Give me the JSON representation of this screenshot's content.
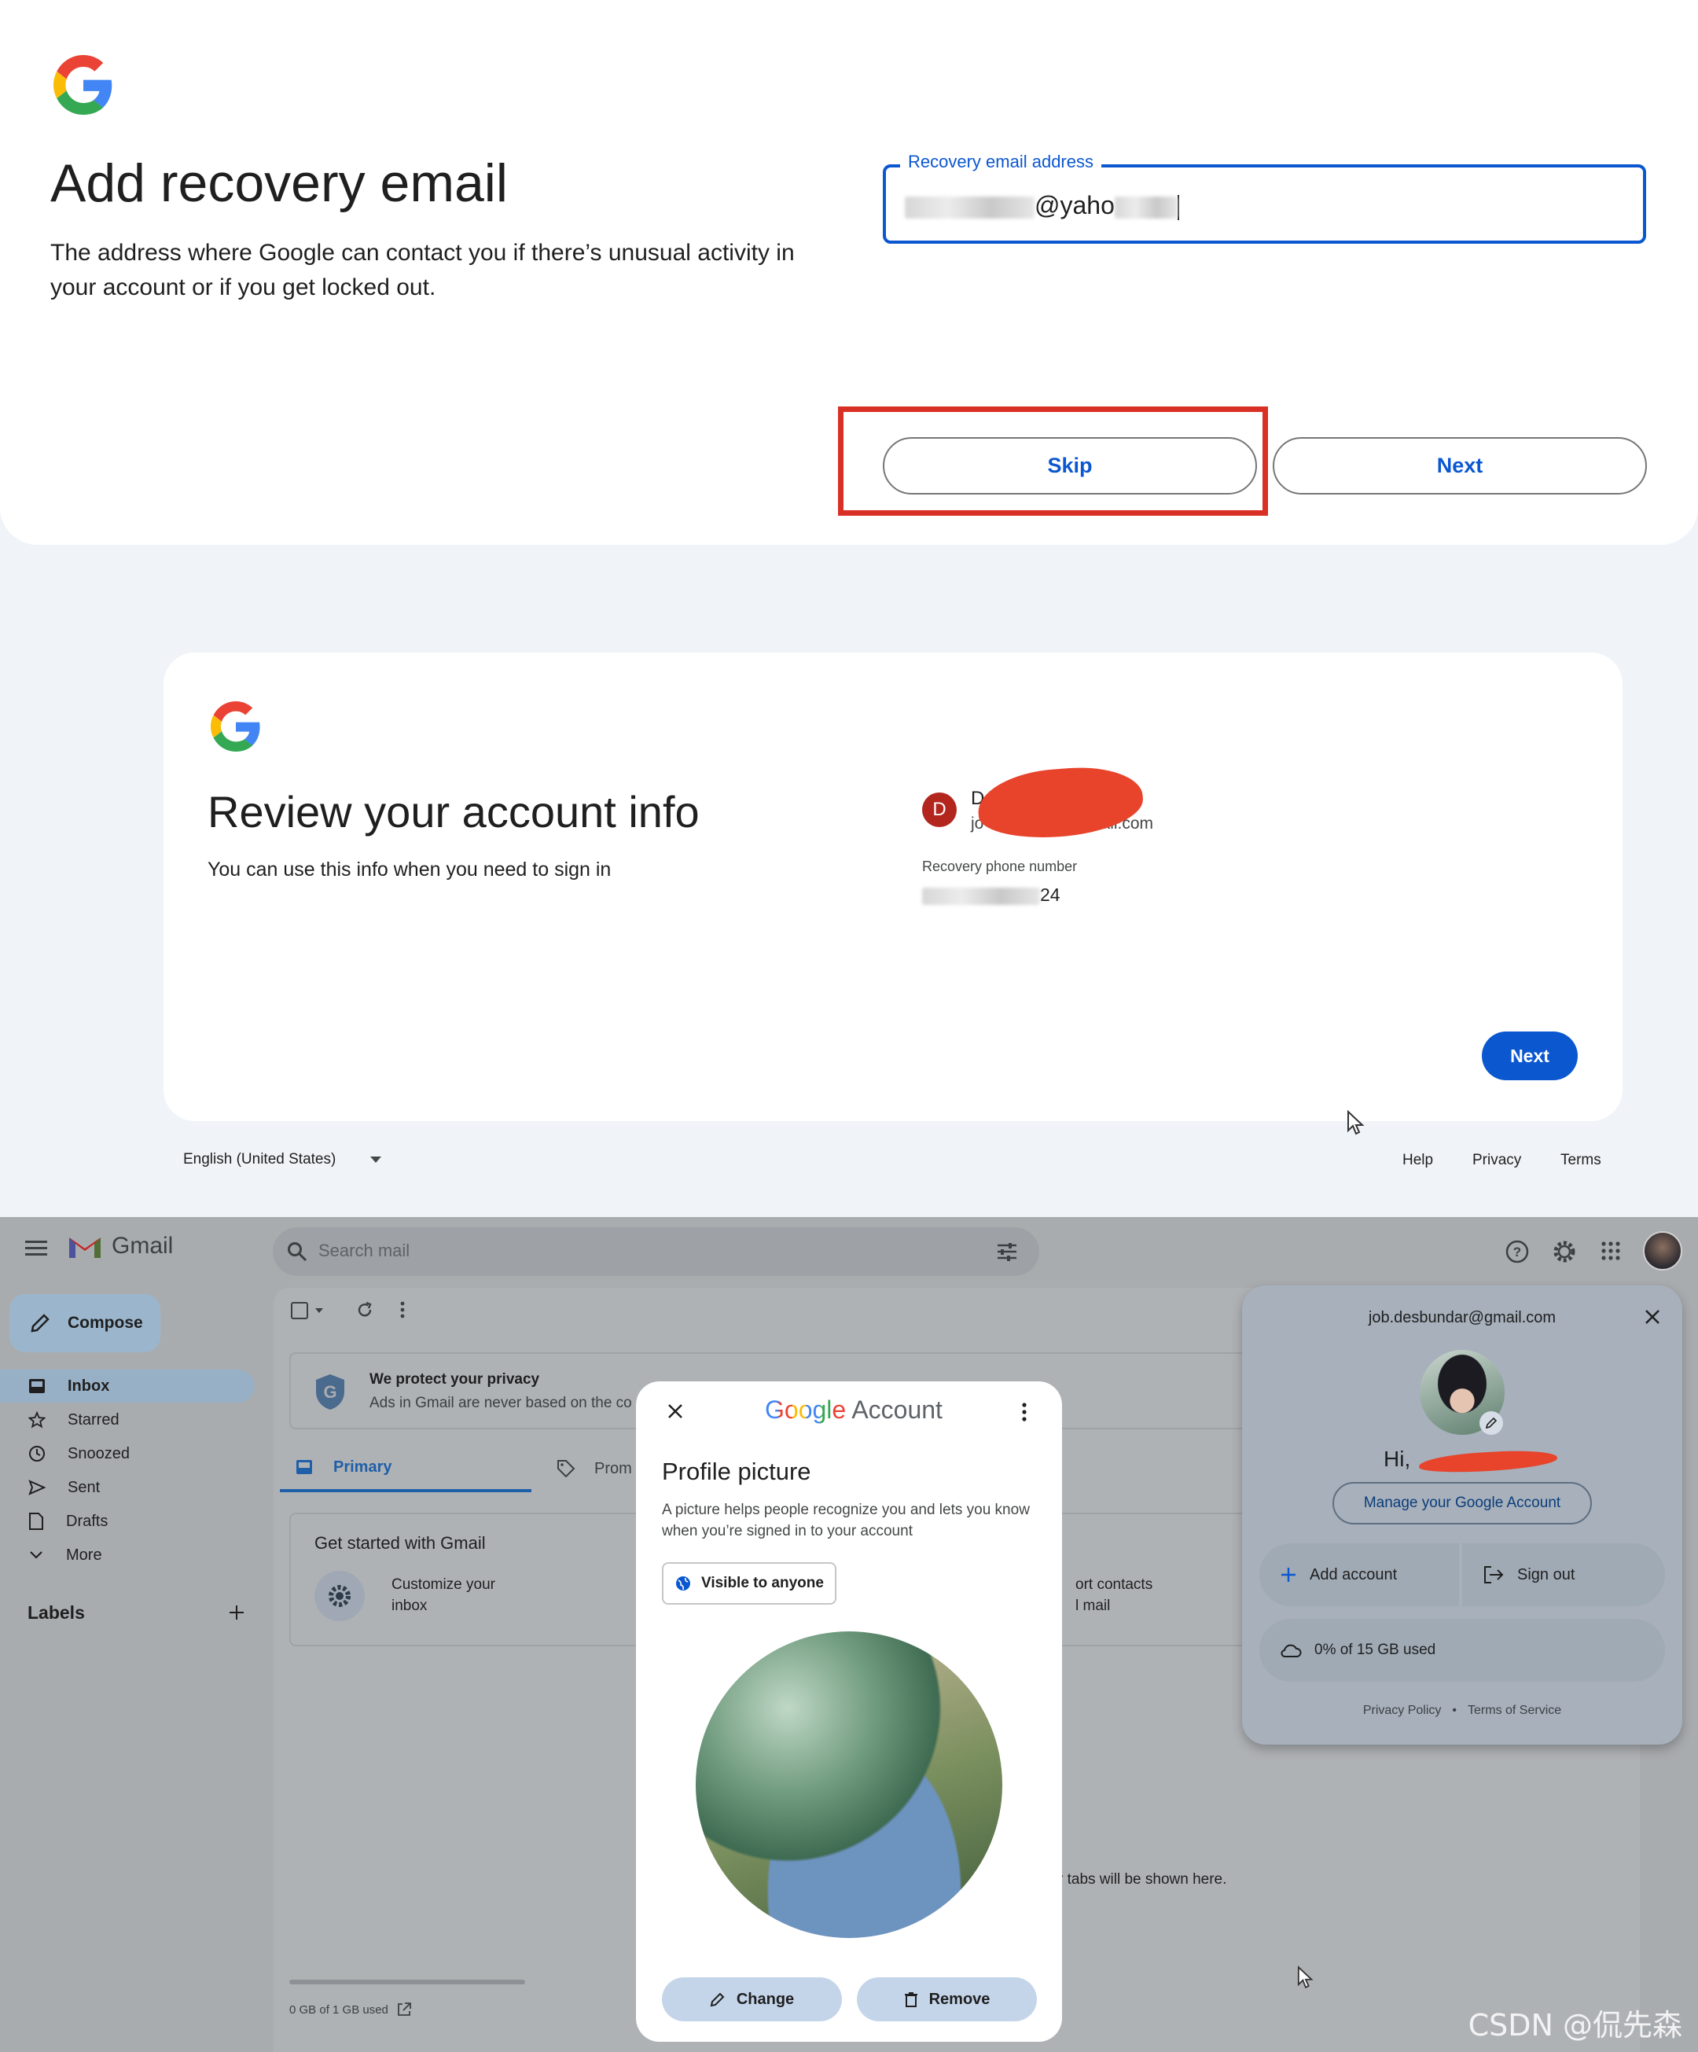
{
  "recovery": {
    "title": "Add recovery email",
    "description": "The address where Google can contact you if there’s unusual activity in your account or if you get locked out.",
    "field_label": "Recovery email address",
    "field_value_visible": "@yaho",
    "skip_label": "Skip",
    "next_label": "Next"
  },
  "review": {
    "title": "Review your account info",
    "description": "You can use this info when you need to sign in",
    "avatar_letter": "D",
    "name_visible": "D",
    "email_prefix_visible": "jo",
    "email_suffix_visible": "gmail.com",
    "phone_label": "Recovery phone number",
    "phone_suffix_visible": "24",
    "next_label": "Next",
    "language": "English (United States)",
    "footer": {
      "help": "Help",
      "privacy": "Privacy",
      "terms": "Terms"
    }
  },
  "gmail": {
    "app_name": "Gmail",
    "search_placeholder": "Search mail",
    "compose_label": "Compose",
    "nav": [
      {
        "label": "Inbox",
        "icon": "inbox-icon"
      },
      {
        "label": "Starred",
        "icon": "star-icon"
      },
      {
        "label": "Snoozed",
        "icon": "clock-icon"
      },
      {
        "label": "Sent",
        "icon": "send-icon"
      },
      {
        "label": "Drafts",
        "icon": "draft-icon"
      },
      {
        "label": "More",
        "icon": "chevron-down-icon"
      }
    ],
    "labels_heading": "Labels",
    "privacy_title": "We protect your privacy",
    "privacy_text": "Ads in Gmail are never based on the co",
    "tab_primary": "Primary",
    "tab_promotions": "Prom",
    "get_started": "Get started with Gmail",
    "customize_line1": "Customize your",
    "customize_line2": "inbox",
    "import_line1": "ort contacts",
    "import_line2": "l mail",
    "tabs_note": "r tabs will be shown here.",
    "storage": "0 GB of 1 GB used"
  },
  "dialog": {
    "brand_word": "Google",
    "brand_suffix": "Account",
    "title": "Profile picture",
    "description": "A picture helps people recognize you and lets you know when you’re signed in to your account",
    "visibility": "Visible to anyone",
    "change_label": "Change",
    "remove_label": "Remove"
  },
  "account": {
    "email": "job.desbundar@gmail.com",
    "greeting_visible": "Hi,",
    "manage_label": "Manage your Google Account",
    "add_account": "Add account",
    "sign_out": "Sign out",
    "storage": "0% of 15 GB used",
    "privacy_policy": "Privacy Policy",
    "separator": "•",
    "terms": "Terms of Service"
  },
  "watermark": "CSDN @侃先森",
  "colors": {
    "google_blue": "#4285F4",
    "google_red": "#EA4335",
    "google_yellow": "#FBBC05",
    "google_green": "#34A853",
    "primary_button": "#0b57d0",
    "highlight": "#d93025"
  }
}
